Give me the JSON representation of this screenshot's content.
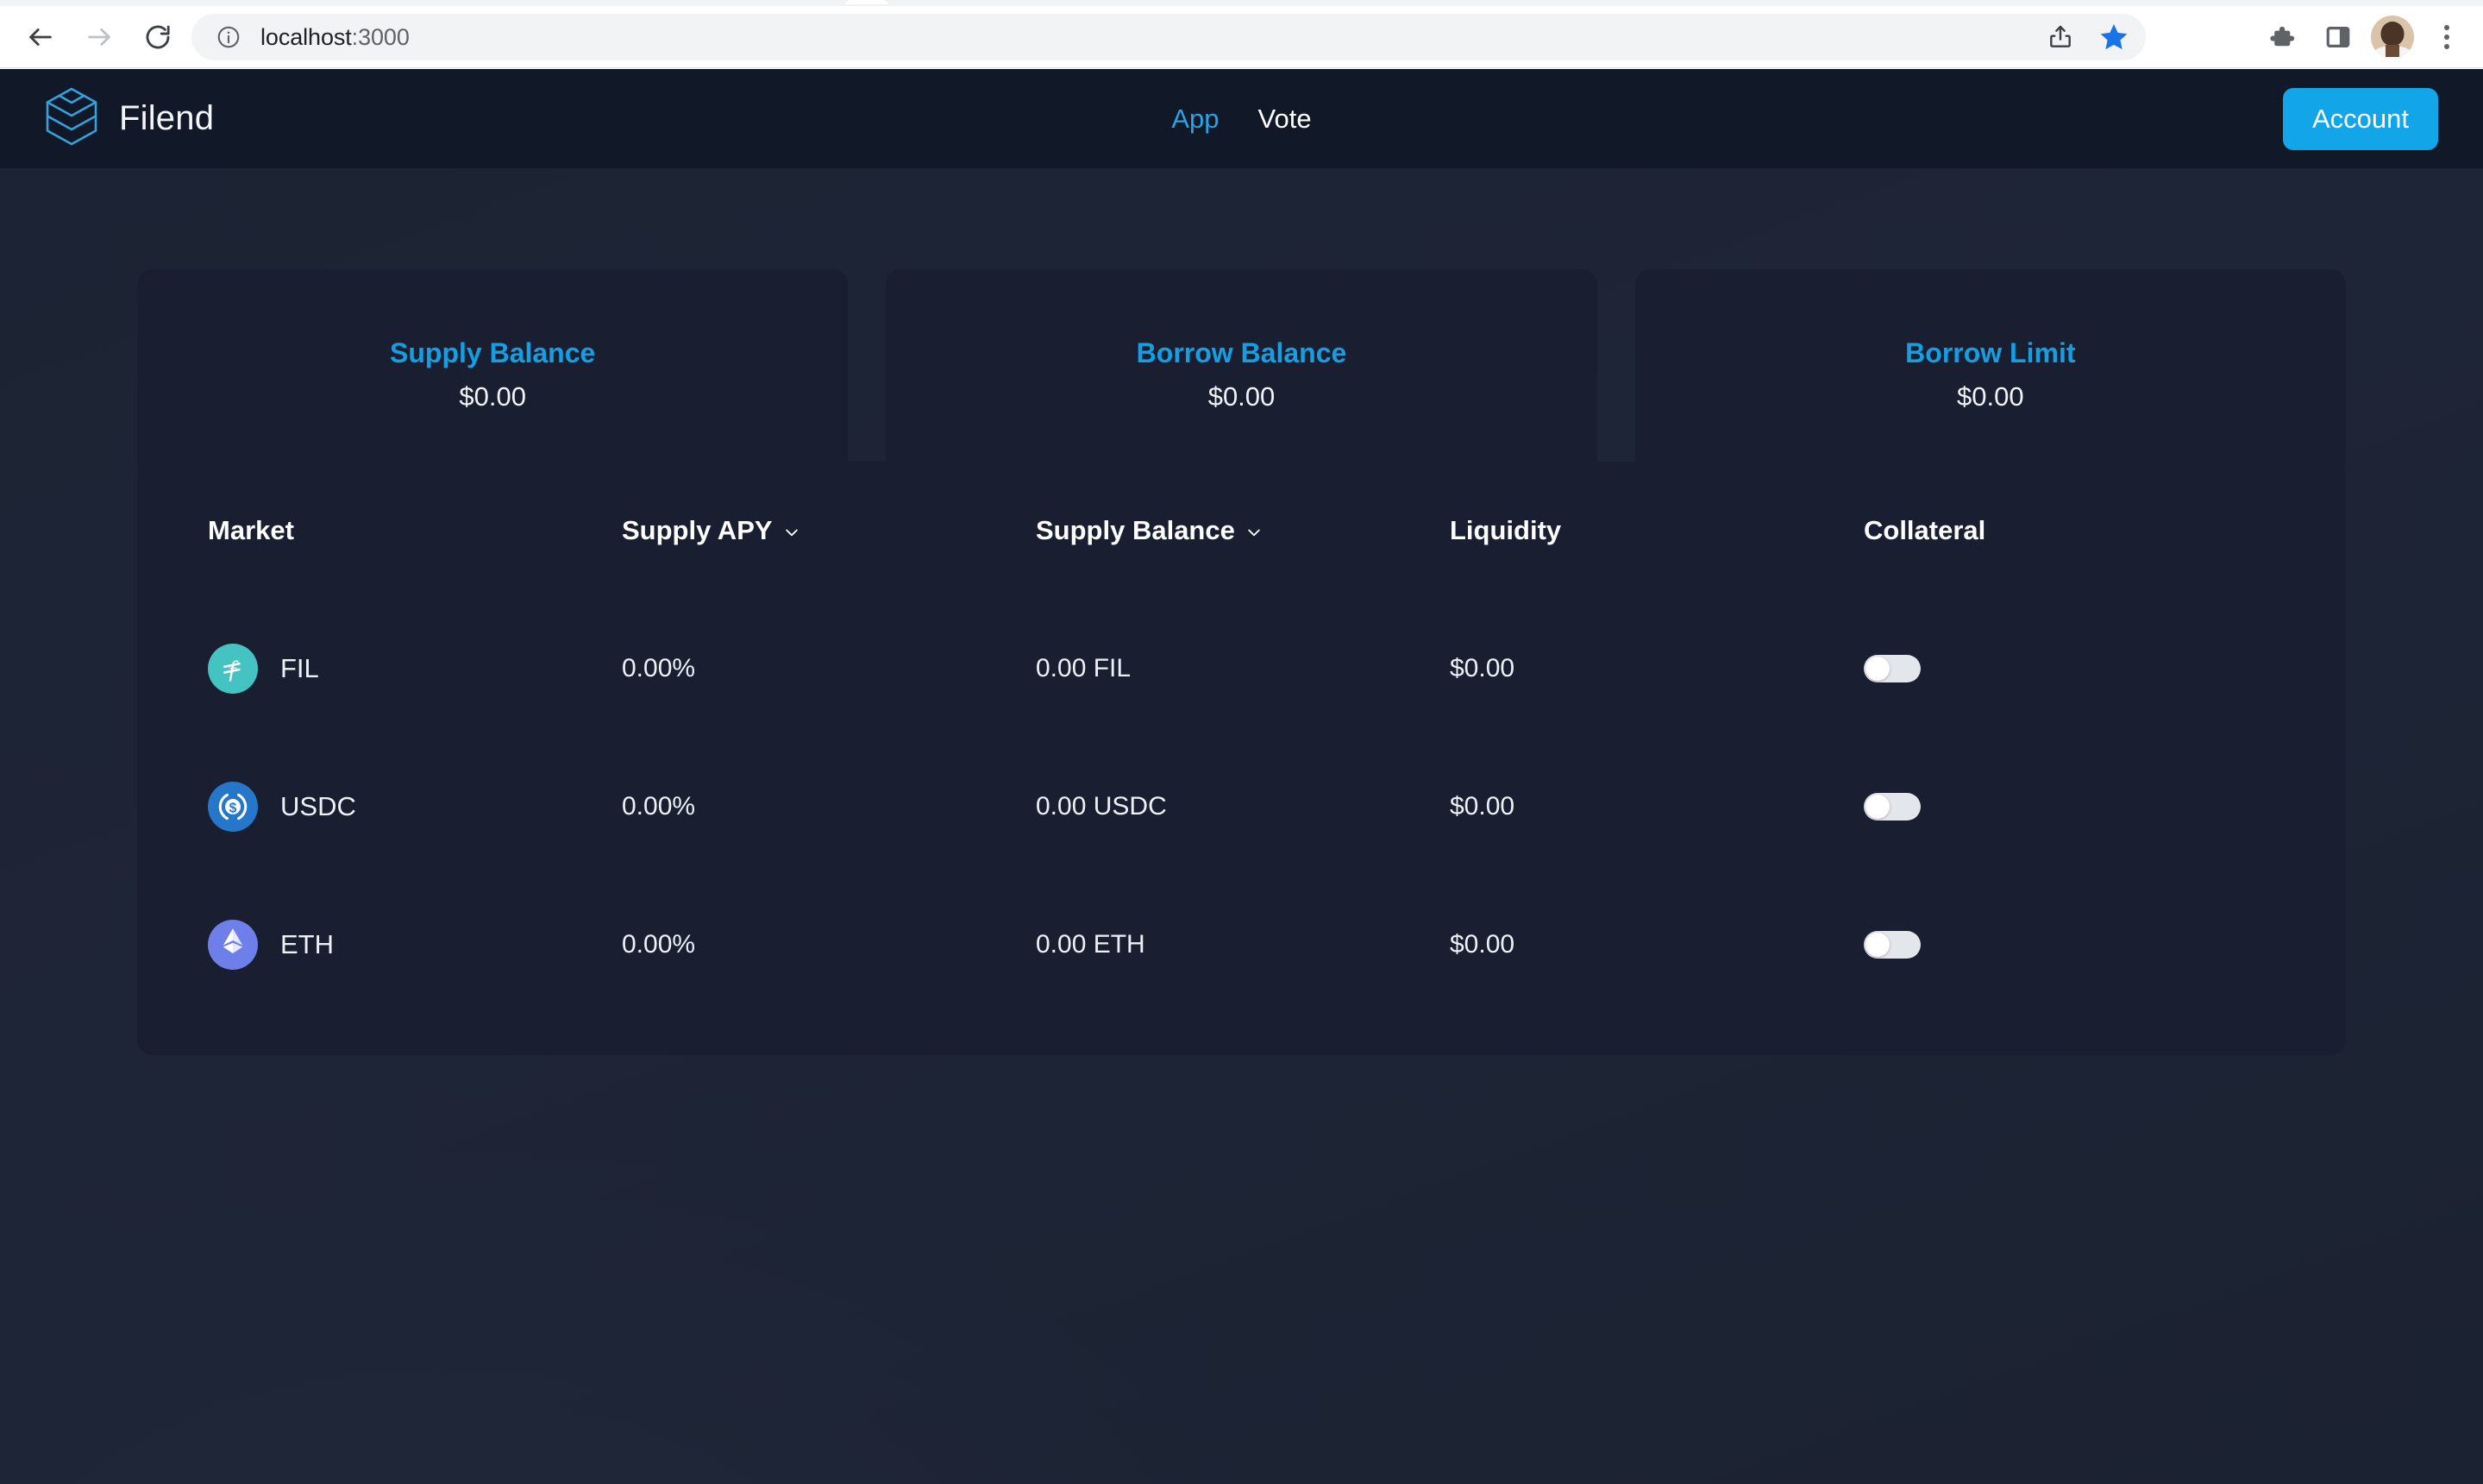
{
  "browser": {
    "url_host": "localhost",
    "url_port": ":3000",
    "back_icon": "back-arrow-icon",
    "forward_icon": "forward-arrow-icon",
    "reload_icon": "reload-icon",
    "info_icon": "site-info-icon",
    "share_icon": "share-icon",
    "bookmark_icon": "bookmark-star-icon",
    "extensions_icon": "extensions-puzzle-icon",
    "side_panel_icon": "side-panel-icon",
    "avatar_icon": "profile-avatar",
    "menu_icon": "three-dot-menu-icon",
    "bookmark_color": "#1a73e8"
  },
  "navbar": {
    "logo_icon": "filend-layers-logo",
    "brand": "Filend",
    "links": [
      {
        "label": "App",
        "active": true
      },
      {
        "label": "Vote",
        "active": false
      }
    ],
    "account_label": "Account",
    "accent": "#12a6e8",
    "background": "#111827"
  },
  "stats": [
    {
      "title": "Supply Balance",
      "value": "$0.00"
    },
    {
      "title": "Borrow Balance",
      "value": "$0.00"
    },
    {
      "title": "Borrow Limit",
      "value": "$0.00"
    }
  ],
  "market_table": {
    "columns": [
      {
        "label": "Market",
        "sortable": false
      },
      {
        "label": "Supply APY",
        "sortable": true
      },
      {
        "label": "Supply Balance",
        "sortable": true
      },
      {
        "label": "Liquidity",
        "sortable": false
      },
      {
        "label": "Collateral",
        "sortable": false
      }
    ],
    "rows": [
      {
        "symbol": "FIL",
        "icon": "fil-coin-icon",
        "icon_color": "#45c3c2",
        "supply_apy": "0.00%",
        "supply_balance": "0.00 FIL",
        "liquidity": "$0.00",
        "collateral_on": false
      },
      {
        "symbol": "USDC",
        "icon": "usdc-coin-icon",
        "icon_color": "#2676c9",
        "supply_apy": "0.00%",
        "supply_balance": "0.00 USDC",
        "liquidity": "$0.00",
        "collateral_on": false
      },
      {
        "symbol": "ETH",
        "icon": "eth-coin-icon",
        "icon_color": "#6f7fe9",
        "supply_apy": "0.00%",
        "supply_balance": "0.00 ETH",
        "liquidity": "$0.00",
        "collateral_on": false
      }
    ]
  },
  "theme": {
    "page_background": "#1d2435",
    "card_background": "#191f30",
    "accent_blue": "#159fe2",
    "text_primary": "#edf0f5"
  }
}
